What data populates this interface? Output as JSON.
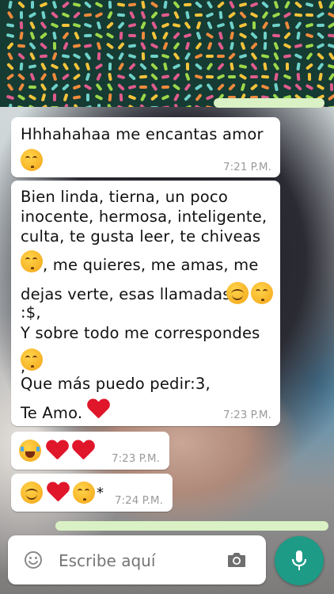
{
  "messages": [
    {
      "lines": [
        "Hhhahahaa me encantas amor"
      ],
      "time": "7:21 P.M."
    },
    {
      "lines": [
        "Bien linda, tierna, un poco",
        "inocente, hermosa, inteligente,",
        "culta, te gusta leer, te chiveas",
        ", me quieres, me amas, me",
        "dejas verte, esas llamadas",
        ":$,",
        "Y sobre todo me correspondes",
        ",",
        "Que más puedo pedir:3,",
        "Te Amo."
      ],
      "time": "7:23 P.M."
    },
    {
      "time": "7:23 P.M."
    },
    {
      "suffix": "*",
      "time": "7:24 P.M."
    }
  ],
  "composer": {
    "placeholder": "Escribe aquí"
  },
  "colors": {
    "accent": "#1d9b86",
    "bubble": "#ffffff",
    "timestamp": "#9a9a9a"
  }
}
